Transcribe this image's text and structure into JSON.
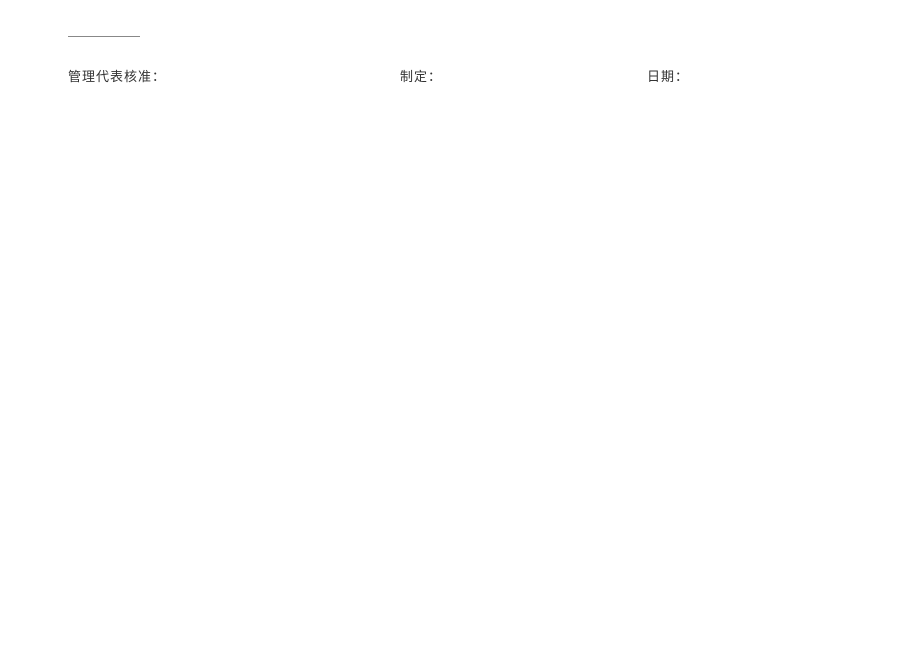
{
  "signature": {
    "approver_label": "管理代表核准：",
    "preparer_label": "制定：",
    "date_label": "日期："
  }
}
